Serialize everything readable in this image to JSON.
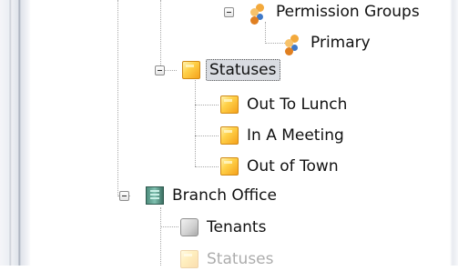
{
  "tree": {
    "permission_groups": {
      "label": "Permission Groups",
      "icon": "user-group-icon",
      "expanded": true
    },
    "primary": {
      "label": "Primary",
      "icon": "user-group-icon"
    },
    "statuses": {
      "label": "Statuses",
      "icon": "status-icon",
      "expanded": true,
      "selected": true
    },
    "status_items": [
      {
        "label": "Out To Lunch",
        "icon": "status-icon"
      },
      {
        "label": "In A Meeting",
        "icon": "status-icon"
      },
      {
        "label": "Out of Town",
        "icon": "status-icon"
      }
    ],
    "branch_office": {
      "label": "Branch Office",
      "icon": "building-icon",
      "expanded": true
    },
    "tenants": {
      "label": "Tenants",
      "icon": "tenants-icon"
    },
    "statuses_2": {
      "label": "Statuses",
      "icon": "status-icon"
    }
  },
  "colors": {
    "selection_background": "#d9dce2",
    "tree_line": "#a8a8a8",
    "status_icon": "#f5a21b"
  }
}
